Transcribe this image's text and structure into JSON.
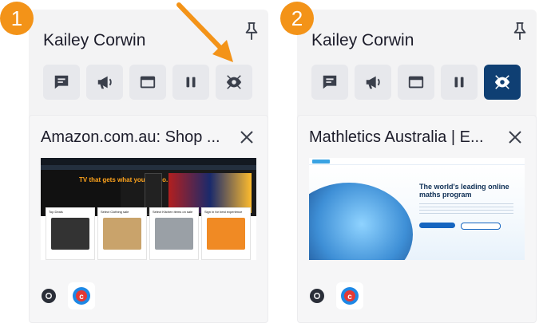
{
  "steps": [
    "1",
    "2"
  ],
  "panels": [
    {
      "student_name": "Kailey Corwin",
      "toolbar": [
        {
          "icon": "message-icon",
          "active": false
        },
        {
          "icon": "megaphone-icon",
          "active": false
        },
        {
          "icon": "window-icon",
          "active": false
        },
        {
          "icon": "pause-icon",
          "active": false
        },
        {
          "icon": "focus-icon",
          "active": false
        }
      ],
      "tab": {
        "title": "Amazon.com.au: Shop ...",
        "favicon": "chrome-icon",
        "extension_icon": "app-extension-icon",
        "thumbnail": {
          "hero_text": "TV that gets what you're into.",
          "cards": [
            "Top Deals",
            "Select Clothing sale",
            "Select Kitchen items on sale",
            "Sign in for best experience"
          ]
        }
      }
    },
    {
      "student_name": "Kailey Corwin",
      "toolbar": [
        {
          "icon": "message-icon",
          "active": false
        },
        {
          "icon": "megaphone-icon",
          "active": false
        },
        {
          "icon": "window-icon",
          "active": false
        },
        {
          "icon": "pause-icon",
          "active": false
        },
        {
          "icon": "focus-icon",
          "active": true
        }
      ],
      "tab": {
        "title": "Mathletics Australia | E...",
        "favicon": "chrome-icon",
        "extension_icon": "app-extension-icon",
        "thumbnail": {
          "headline": "The world's leading online maths program"
        }
      }
    }
  ],
  "colors": {
    "badge": "#f39318",
    "active_button": "#0f3f73",
    "button_bg": "#e7e8ec",
    "icon": "#3a3f4b",
    "arrow": "#f39318"
  }
}
